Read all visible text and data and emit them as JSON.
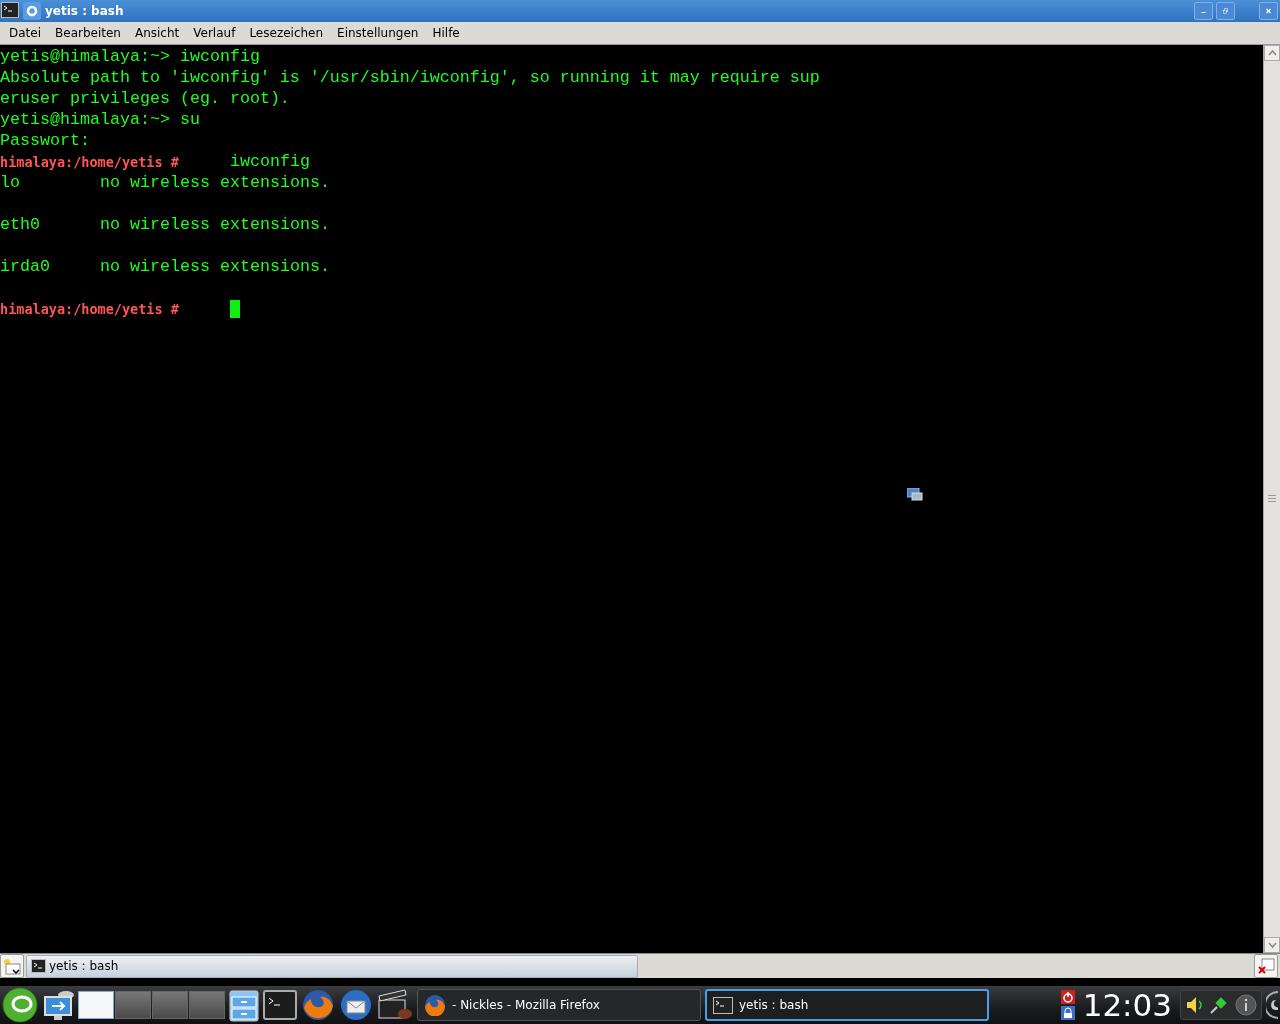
{
  "window": {
    "title": "yetis : bash"
  },
  "menu": [
    "Datei",
    "Bearbeiten",
    "Ansicht",
    "Verlauf",
    "Lesezeichen",
    "Einstellungen",
    "Hilfe"
  ],
  "terminal": {
    "lines": [
      {
        "kind": "command",
        "prompt": "yetis@himalaya:~>",
        "command": "iwconfig"
      },
      {
        "kind": "output",
        "text": "Absolute path to 'iwconfig' is '/usr/sbin/iwconfig', so running it may require sup"
      },
      {
        "kind": "output",
        "text": "eruser privileges (eg. root)."
      },
      {
        "kind": "command",
        "prompt": "yetis@himalaya:~>",
        "command": "su"
      },
      {
        "kind": "output",
        "text": "Passwort:"
      },
      {
        "kind": "root",
        "prompt": "himalaya:/home/yetis #",
        "command": "iwconfig",
        "cursor": false
      },
      {
        "kind": "iface",
        "name": "lo",
        "text": "no wireless extensions."
      },
      {
        "kind": "blank"
      },
      {
        "kind": "iface",
        "name": "eth0",
        "text": "no wireless extensions."
      },
      {
        "kind": "blank"
      },
      {
        "kind": "iface",
        "name": "irda0",
        "text": "no wireless extensions."
      },
      {
        "kind": "blank"
      },
      {
        "kind": "root",
        "prompt": "himalaya:/home/yetis #",
        "cursor": true
      }
    ]
  },
  "tabs": [
    {
      "label": "yetis : bash",
      "selected": true
    }
  ],
  "taskbar": {
    "desktops": [
      {
        "selected": true
      },
      {
        "selected": false
      },
      {
        "selected": false
      },
      {
        "selected": false
      }
    ],
    "tasks": [
      {
        "kind": "browser",
        "label": "- Nickles - Mozilla Firefox",
        "selected": false
      },
      {
        "kind": "terminal",
        "label": "yetis : bash",
        "selected": true
      }
    ],
    "clock": "12:03"
  }
}
